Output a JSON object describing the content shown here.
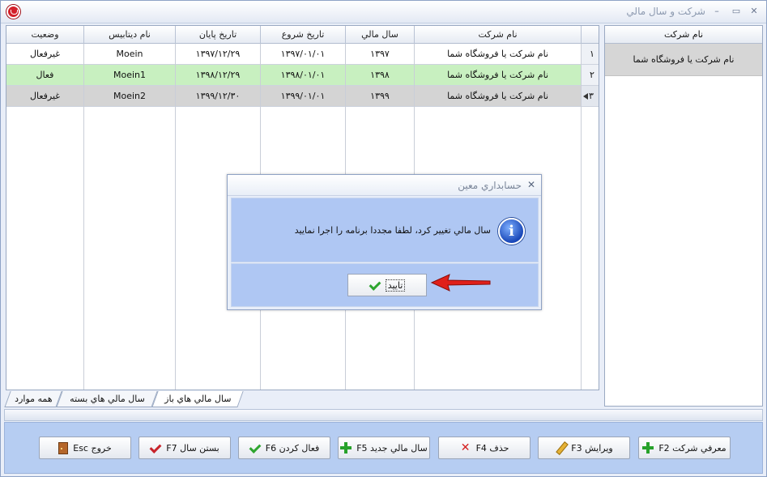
{
  "window": {
    "title": "شرکت و سال مالي",
    "minimize": "–",
    "maximize": "▭",
    "close": "✕"
  },
  "grid": {
    "columns": [
      "وضعیت",
      "نام دیتابیس",
      "تاریخ پایان",
      "تاریخ شروع",
      "سال مالي",
      "نام شرکت"
    ],
    "rows": [
      {
        "index": "۱",
        "status": "غیرفعال",
        "database": "Moein",
        "end": "۱۳۹۷/۱۲/۲۹",
        "start": "۱۳۹۷/۰۱/۰۱",
        "year": "۱۳۹۷",
        "company": "نام شرکت یا فروشگاه شما"
      },
      {
        "index": "۲",
        "status": "فعال",
        "database": "Moein1",
        "end": "۱۳۹۸/۱۲/۲۹",
        "start": "۱۳۹۸/۰۱/۰۱",
        "year": "۱۳۹۸",
        "company": "نام شرکت یا فروشگاه شما"
      },
      {
        "index": "۳",
        "status": "غیرفعال",
        "database": "Moein2",
        "end": "۱۳۹۹/۱۲/۳۰",
        "start": "۱۳۹۹/۰۱/۰۱",
        "year": "۱۳۹۹",
        "company": "نام شرکت یا فروشگاه شما"
      }
    ]
  },
  "side_panel": {
    "header": "نام شرکت",
    "item": "نام شرکت یا فروشگاه شما"
  },
  "tabs": {
    "open": "سال مالي هاي باز",
    "closed": "سال مالي هاي بسته",
    "all": "همه موارد"
  },
  "toolbar": {
    "introduce": "معرفي شرکت F2",
    "edit": "ویرایش F3",
    "delete": "حذف F4",
    "new_year": "سال مالي جدید F5",
    "activate": "فعال کردن F6",
    "close_year": "بستن سال F7",
    "exit": "خروج Esc"
  },
  "dialog": {
    "title": "حسابداري معين",
    "close": "✕",
    "icon": "i",
    "message": "سال مالي تغيير کرد، لطفا مجددا برنامه را اجرا نماييد",
    "ok": "تایید"
  },
  "colors": {
    "active_row": "#c8f0c0",
    "selected_row": "#d4d4d4",
    "toolbar_bg": "#b6cdf2",
    "dialog_panel": "#afc7f3",
    "arrow": "#e0201a"
  }
}
